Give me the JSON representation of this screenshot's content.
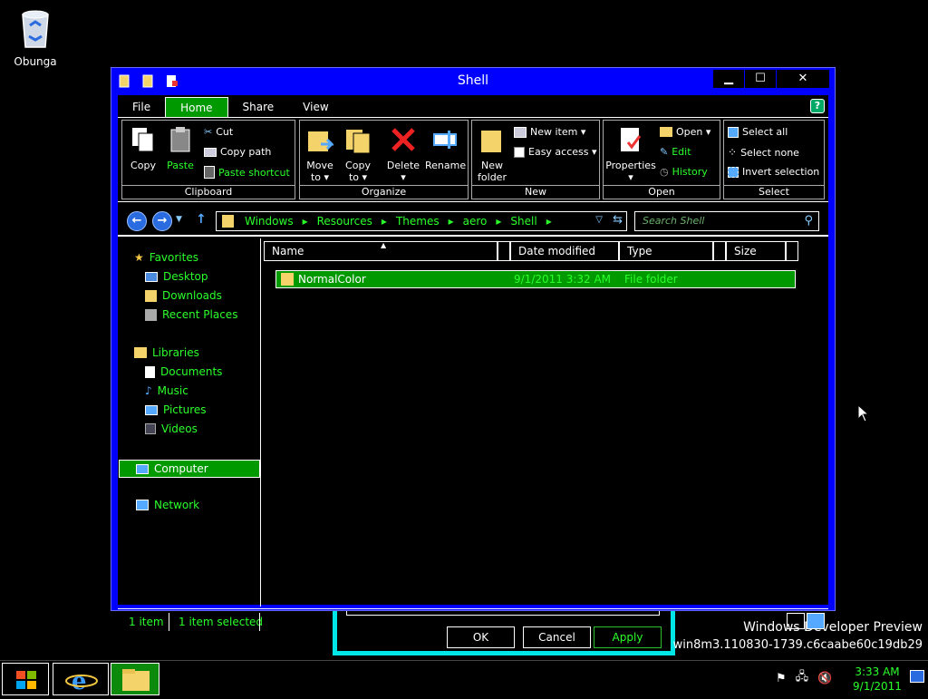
{
  "desktop": {
    "recycle_label": "Obunga"
  },
  "window": {
    "title": "Shell",
    "controls": {
      "min": "▁",
      "max": "☐",
      "close": "✕"
    }
  },
  "ribbon": {
    "tabs": [
      {
        "label": "File"
      },
      {
        "label": "Home"
      },
      {
        "label": "Share"
      },
      {
        "label": "View"
      }
    ],
    "help": "?",
    "clipboard": {
      "name": "Clipboard",
      "copy": "Copy",
      "paste": "Paste",
      "cut": "Cut",
      "copy_path": "Copy path",
      "paste_shortcut": "Paste shortcut"
    },
    "organize": {
      "name": "Organize",
      "move_l1": "Move",
      "move_l2": "to ▾",
      "copy_l1": "Copy",
      "copy_l2": "to ▾",
      "delete_l1": "Delete",
      "delete_l2": "▾",
      "rename": "Rename"
    },
    "new": {
      "name": "New",
      "folder_l1": "New",
      "folder_l2": "folder",
      "new_item": "New item ▾",
      "easy_access": "Easy access ▾"
    },
    "open": {
      "name": "Open",
      "properties_l1": "Properties",
      "properties_l2": "▾",
      "open": "Open ▾",
      "edit": "Edit",
      "history": "History"
    },
    "select": {
      "name": "Select",
      "all": "Select all",
      "none": "Select none",
      "invert": "Invert selection"
    }
  },
  "address": {
    "crumbs": [
      "Windows",
      "Resources",
      "Themes",
      "aero",
      "Shell"
    ],
    "search_placeholder": "Search Shell"
  },
  "nav": {
    "favorites": "Favorites",
    "desktop": "Desktop",
    "downloads": "Downloads",
    "recent": "Recent Places",
    "libraries": "Libraries",
    "documents": "Documents",
    "music": "Music",
    "pictures": "Pictures",
    "videos": "Videos",
    "computer": "Computer",
    "network": "Network"
  },
  "filelist": {
    "columns": {
      "name": "Name",
      "date": "Date modified",
      "type": "Type",
      "size": "Size"
    },
    "rows": [
      {
        "name": "NormalColor",
        "date": "9/1/2011 3:32 AM",
        "type": "File folder"
      }
    ]
  },
  "status": {
    "count": "1 item",
    "selected": "1 item selected"
  },
  "dialog": {
    "ok": "OK",
    "cancel": "Cancel",
    "apply": "Apply"
  },
  "watermark": {
    "line1": "Windows Developer Preview",
    "line2": "win8m3.110830-1739.c6caabe60c19db29"
  },
  "taskbar": {
    "time": "3:33 AM",
    "date": "9/1/2011"
  },
  "colors": {
    "window_frame": "#0000ff",
    "accent_green": "#009900",
    "text_green": "#2bff2b",
    "dialog_cyan": "#00e5e5"
  }
}
